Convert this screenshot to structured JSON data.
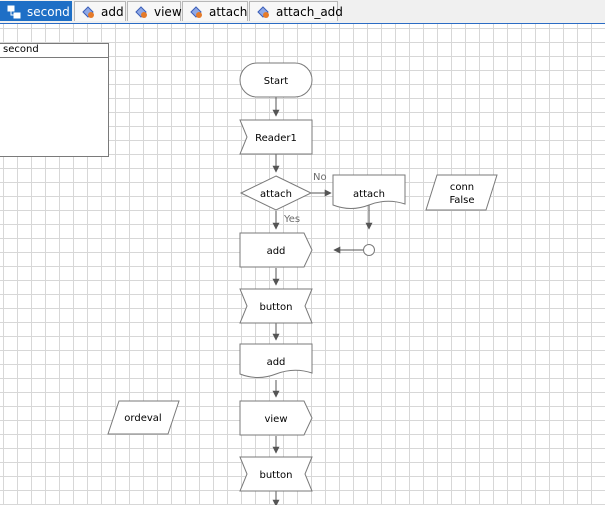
{
  "tabs": [
    {
      "label": "second",
      "active": true
    },
    {
      "label": "add",
      "active": false
    },
    {
      "label": "view",
      "active": false
    },
    {
      "label": "attach",
      "active": false
    },
    {
      "label": "attach_add",
      "active": false
    }
  ],
  "panel": {
    "title": "second"
  },
  "flow": {
    "start": "Start",
    "reader": "Reader1",
    "decision": "attach",
    "decision_no": "No",
    "decision_yes": "Yes",
    "attach_doc": "attach",
    "conn_line1": "conn",
    "conn_line2": "False",
    "add1": "add",
    "button1": "button",
    "add2": "add",
    "view": "view",
    "button2": "button",
    "ordeval": "ordeval"
  },
  "colors": {
    "accent": "#1e6fc6",
    "shape_stroke": "#7a7a7a",
    "connector": "#555555",
    "grid": "#d7d7d7"
  }
}
